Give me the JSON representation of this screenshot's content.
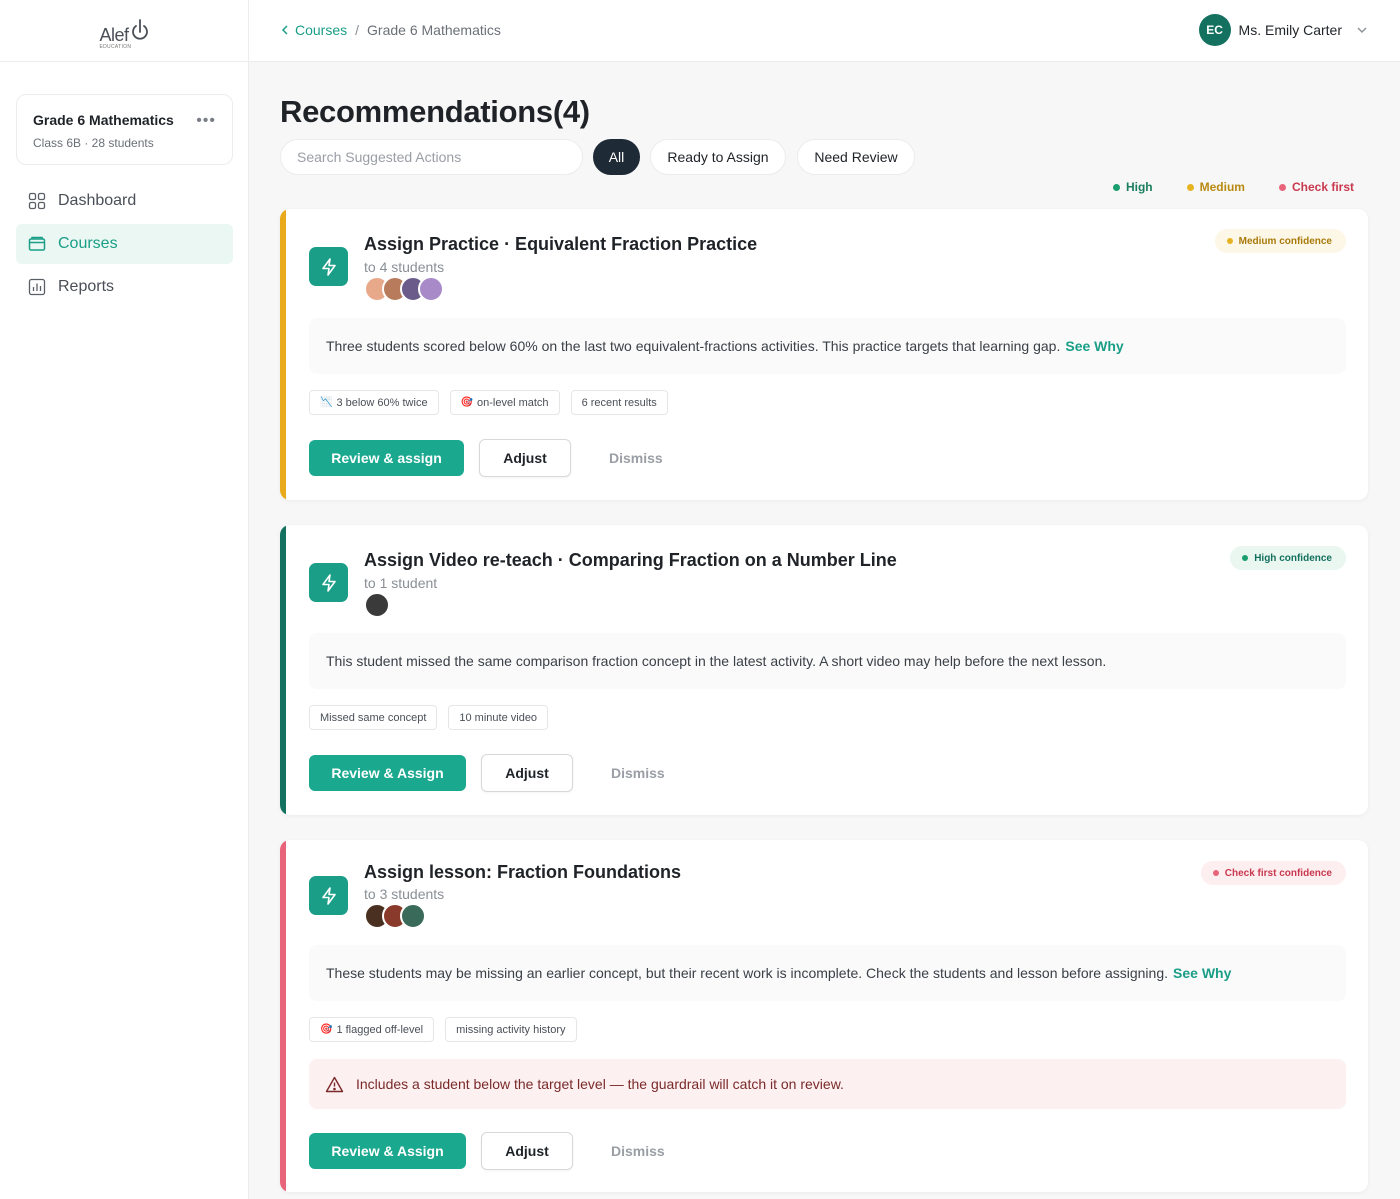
{
  "brand": {
    "name": "Alef",
    "sub": "EDUCATION"
  },
  "course_card": {
    "title": "Grade 6 Mathematics",
    "subtitle": "Class 6B · 28 students",
    "more": "•••"
  },
  "nav": [
    {
      "label": "Dashboard",
      "icon": "grid-icon",
      "active": false
    },
    {
      "label": "Courses",
      "icon": "folder-icon",
      "active": true
    },
    {
      "label": "Reports",
      "icon": "bar-chart-icon",
      "active": false
    }
  ],
  "breadcrumb": {
    "back_label": "Courses",
    "separator": "/",
    "current": "Grade 6 Mathematics"
  },
  "user": {
    "initials": "EC",
    "name": "Ms. Emily Carter"
  },
  "page": {
    "title": "Recommendations(4)"
  },
  "search": {
    "placeholder": "Search Suggested Actions",
    "value": ""
  },
  "filters": [
    "All",
    "Ready to Assign",
    "Need Review"
  ],
  "legend": [
    {
      "label": "High",
      "color": "#1a9e6e"
    },
    {
      "label": "Medium",
      "color": "#e6b422"
    },
    {
      "label": "Check first",
      "color": "#e8647a"
    }
  ],
  "colors": {
    "accent": "#1a9e87",
    "medium": "#e8a91a",
    "high": "#14715f",
    "check_first": "#e8647a"
  },
  "cards": [
    {
      "title": "Assign Practice · Equivalent Fraction Practice",
      "subtitle": "to 4 students",
      "confidence": "Medium confidence",
      "reason": "Three students scored below 60% on the last two equivalent-fractions activities. This practice targets that learning gap.",
      "see_why": "See Why",
      "chips": [
        "3 below 60% twice",
        "on-level match",
        "6 recent results"
      ],
      "primary": "Review & assign",
      "secondary": "Adjust",
      "dismiss": "Dismiss"
    },
    {
      "title": "Assign Video re-teach · Comparing Fraction on a Number Line",
      "subtitle": "to 1 student",
      "confidence": "High confidence",
      "reason": "This student missed the same comparison fraction concept in the latest activity. A short video may help before the next lesson.",
      "chips": [
        "Missed same concept",
        "10 minute video"
      ],
      "primary": "Review & Assign",
      "secondary": "Adjust",
      "dismiss": "Dismiss"
    },
    {
      "title": "Assign lesson: Fraction Foundations",
      "subtitle": "to 3 students",
      "confidence": "Check first confidence",
      "reason": "These students may be missing an earlier concept, but their recent work is incomplete. Check the students and lesson before assigning.",
      "see_why": "See Why",
      "chips": [
        "1 flagged off-level",
        "missing activity history"
      ],
      "warning": "Includes a student below the target level — the guardrail will catch it on review.",
      "primary": "Review & Assign",
      "secondary": "Adjust",
      "dismiss": "Dismiss"
    }
  ]
}
